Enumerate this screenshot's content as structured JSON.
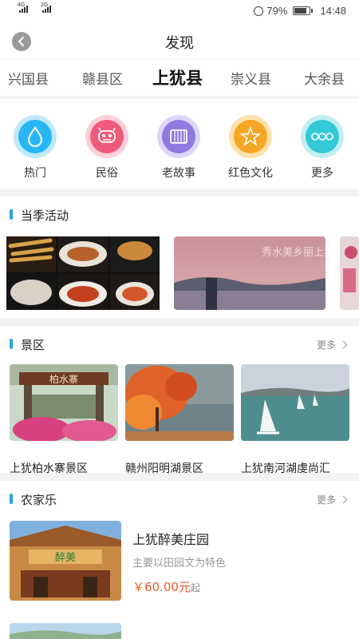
{
  "status_bar": {
    "network_1": "4G",
    "network_2": "2G",
    "battery_percent": "79%",
    "battery_level": 0.79,
    "time": "14:48"
  },
  "header": {
    "title": "发现"
  },
  "county_tabs": [
    {
      "label": "兴国县",
      "active": false
    },
    {
      "label": "赣县区",
      "active": false
    },
    {
      "label": "上犹县",
      "active": true
    },
    {
      "label": "崇义县",
      "active": false
    },
    {
      "label": "大余县",
      "active": false
    }
  ],
  "categories": [
    {
      "label": "热门",
      "icon": "water-drop-icon",
      "color": "#29b6f6"
    },
    {
      "label": "民俗",
      "icon": "lion-mask-icon",
      "color": "#ef5b7a"
    },
    {
      "label": "老故事",
      "icon": "scroll-icon",
      "color": "#8f7ae0"
    },
    {
      "label": "红色文化",
      "icon": "star-icon",
      "color": "#f5a623"
    },
    {
      "label": "更多",
      "icon": "more-dots-icon",
      "color": "#35c8d6"
    }
  ],
  "seasonal": {
    "title": "当季活动",
    "banner_calligraphy": "秀水美乡丽上犹"
  },
  "scenic": {
    "title": "景区",
    "more": "更多",
    "gate_sign": "柏水寨",
    "spots": [
      {
        "name": "上犹柏水寨景区"
      },
      {
        "name": "赣州阳明湖景区"
      },
      {
        "name": "上犹南河湖虔尚汇"
      }
    ]
  },
  "farm": {
    "title": "农家乐",
    "more": "更多",
    "items": [
      {
        "name": "上犹醉美庄园",
        "desc": "主要以田园文为特色",
        "price": "￥60.00元",
        "price_suffix": "起",
        "sign": "醉美"
      }
    ]
  }
}
